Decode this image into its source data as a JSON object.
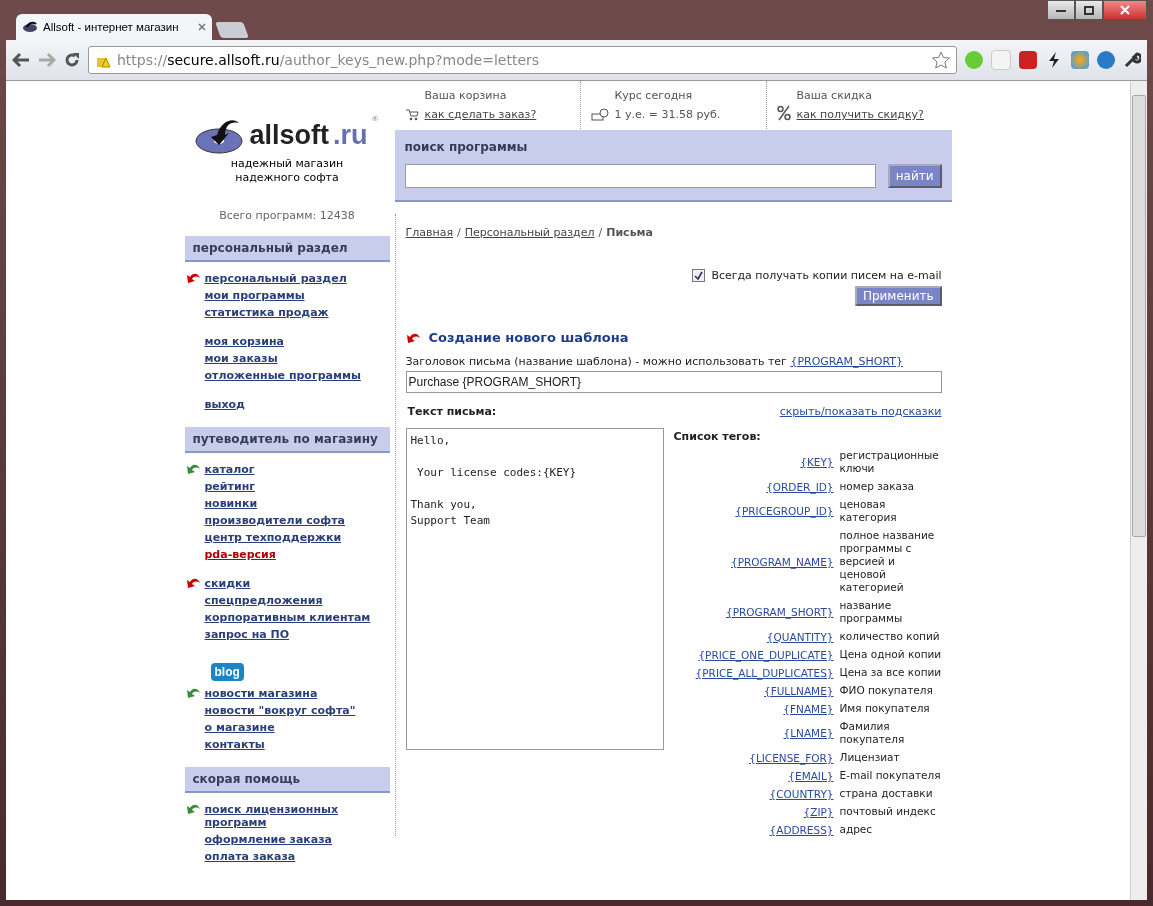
{
  "browser": {
    "tab_title": "Allsoft - интернет магазин",
    "url_scheme": "https://",
    "url_host": "secure.allsoft.ru",
    "url_path": "/author_keys_new.php?mode=letters"
  },
  "logo": {
    "name": "allsoft",
    "tld": ".ru",
    "mark": "®",
    "tagline": "надежный магазин надежного софта"
  },
  "program_count": "Всего программ: 12438",
  "sidebar": [
    {
      "title": "персональный раздел",
      "groups": [
        {
          "color": "#cc0000",
          "items": [
            {
              "label": "персональный раздел",
              "highlight": false
            },
            {
              "label": "мои программы",
              "highlight": false
            },
            {
              "label": "статистика продаж",
              "highlight": false
            }
          ]
        },
        {
          "items": [
            {
              "label": "моя корзина",
              "highlight": false
            },
            {
              "label": "мои заказы",
              "highlight": false
            },
            {
              "label": "отложенные программы",
              "highlight": false
            }
          ]
        },
        {
          "items": [
            {
              "label": "выход",
              "highlight": false
            }
          ]
        }
      ]
    },
    {
      "title": "путеводитель по магазину",
      "groups": [
        {
          "color": "#3a8a3a",
          "items": [
            {
              "label": "каталог",
              "highlight": false
            },
            {
              "label": "рейтинг",
              "highlight": false
            },
            {
              "label": "новинки",
              "highlight": false
            },
            {
              "label": "производители софта",
              "highlight": false
            },
            {
              "label": "центр техподдержки",
              "highlight": false
            },
            {
              "label": "pda-версия",
              "highlight": true
            }
          ]
        },
        {
          "color": "#cc0000",
          "items": [
            {
              "label": "скидки",
              "highlight": false
            },
            {
              "label": "спецпредложения",
              "highlight": false
            },
            {
              "label": "корпоративным клиентам",
              "highlight": false
            },
            {
              "label": "запрос на ПО",
              "highlight": false
            }
          ]
        },
        {
          "badge": "blog",
          "color": "#3a8a3a",
          "items": [
            {
              "label": "новости магазина",
              "highlight": false
            },
            {
              "label": "новости \"вокруг софта\"",
              "highlight": false
            },
            {
              "label": "о магазине",
              "highlight": false
            },
            {
              "label": "контакты",
              "highlight": false
            }
          ]
        }
      ]
    },
    {
      "title": "скорая помощь",
      "groups": [
        {
          "color": "#3a8a3a",
          "items": [
            {
              "label": "поиск лицензионных программ",
              "highlight": false
            },
            {
              "label": "оформление заказа",
              "highlight": false
            },
            {
              "label": "оплата заказа",
              "highlight": false
            }
          ]
        }
      ]
    }
  ],
  "info_bar": [
    {
      "kind": "cart",
      "title": "Ваша корзина",
      "text": "как сделать заказ?",
      "link": true
    },
    {
      "kind": "rate",
      "title": "Курс сегодня",
      "text": "1 у.е. = 31.58 руб.",
      "link": false
    },
    {
      "kind": "discount",
      "title": "Ваша скидка",
      "text": "как получить скидку?",
      "link": true
    }
  ],
  "search": {
    "title": "поиск программы",
    "button": "найти"
  },
  "breadcrumb_separator": "/",
  "breadcrumbs": [
    {
      "label": "Главная",
      "link": true
    },
    {
      "label": "Персональный раздел",
      "link": true
    },
    {
      "label": "Письма",
      "link": false
    }
  ],
  "copy_option": {
    "label": "Всегда получать копии писем на e-mail",
    "checked": true,
    "button": "Применить"
  },
  "template": {
    "heading": "Создание нового шаблона",
    "subject_label": "Заголовок письма (название шаблона) - можно использовать тег ",
    "subject_tag": "{PROGRAM_SHORT}",
    "subject_value": "Purchase {PROGRAM_SHORT}",
    "body_label": "Текст письма:",
    "hints_link": "скрыть/показать подсказки",
    "body_value": "Hello,\n\n Your license codes:{KEY}\n\nThank you,\nSupport Team",
    "tags_title": "Список тегов:",
    "tags": [
      {
        "tag": "{KEY}",
        "desc": "регистрационные ключи"
      },
      {
        "tag": "{ORDER_ID}",
        "desc": "номер заказа"
      },
      {
        "tag": "{PRICEGROUP_ID}",
        "desc": "ценовая категория"
      },
      {
        "tag": "{PROGRAM_NAME}",
        "desc": "полное название программы с версией и ценовой категорией"
      },
      {
        "tag": "{PROGRAM_SHORT}",
        "desc": "название программы"
      },
      {
        "tag": "{QUANTITY}",
        "desc": "количество копий"
      },
      {
        "tag": "{PRICE_ONE_DUPLICATE}",
        "desc": "Цена одной копии"
      },
      {
        "tag": "{PRICE_ALL_DUPLICATES}",
        "desc": "Цена за все копии"
      },
      {
        "tag": "{FULLNAME}",
        "desc": "ФИО покупателя"
      },
      {
        "tag": "{FNAME}",
        "desc": "Имя покупателя"
      },
      {
        "tag": "{LNAME}",
        "desc": "Фамилия покупателя"
      },
      {
        "tag": "{LICENSE_FOR}",
        "desc": "Лицензиат"
      },
      {
        "tag": "{EMAIL}",
        "desc": "E-mail покупателя"
      },
      {
        "tag": "{COUNTRY}",
        "desc": "страна доставки"
      },
      {
        "tag": "{ZIP}",
        "desc": "почтовый индекс"
      },
      {
        "tag": "{ADDRESS}",
        "desc": "адрес"
      }
    ]
  }
}
